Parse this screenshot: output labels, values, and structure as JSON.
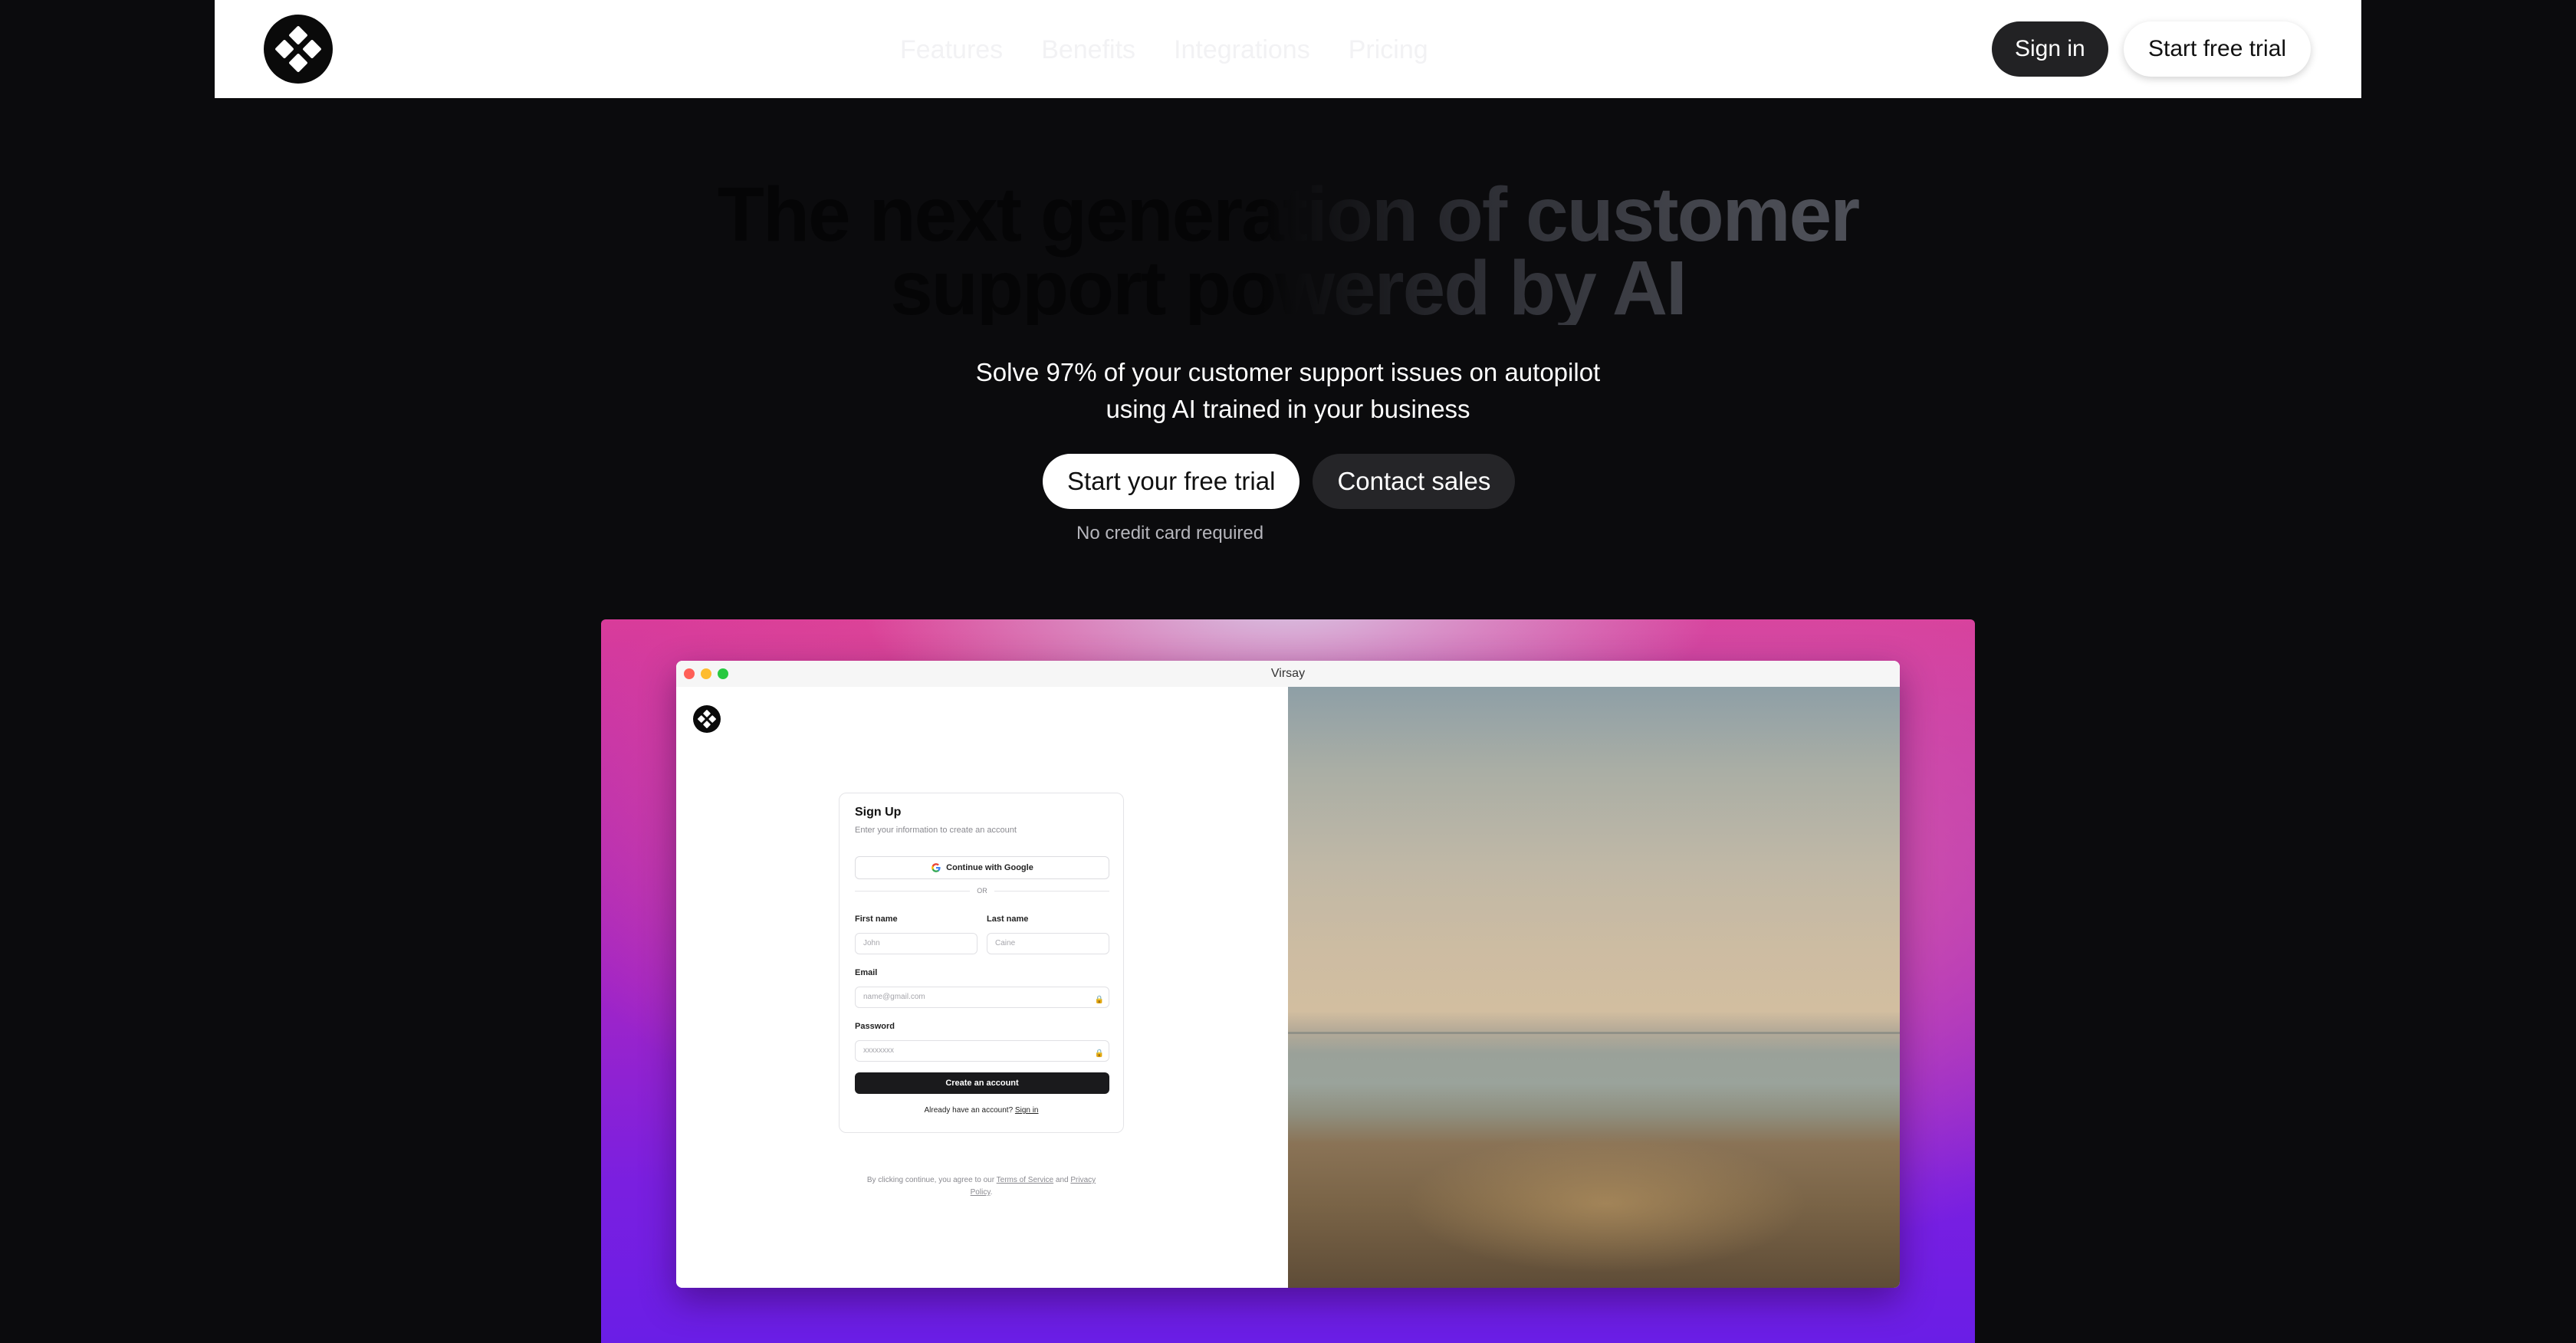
{
  "nav": {
    "links": [
      "Features",
      "Benefits",
      "Integrations",
      "Pricing"
    ],
    "signin_label": "Sign in",
    "trial_label": "Start free trial"
  },
  "hero": {
    "headline_line1": "The next generation of customer",
    "headline_line2": "support powered by AI",
    "subtitle_line1": "Solve 97% of your customer support issues on autopilot",
    "subtitle_line2": "using AI trained in your business",
    "primary_cta": "Start your free trial",
    "secondary_cta": "Contact sales",
    "note": "No credit card required"
  },
  "showcase": {
    "window_title": "Virsay",
    "signup": {
      "title": "Sign Up",
      "description": "Enter your information to create an account",
      "google_button": "Continue with Google",
      "divider": "OR",
      "first_name_label": "First name",
      "first_name_placeholder": "John",
      "last_name_label": "Last name",
      "last_name_placeholder": "Caine",
      "email_label": "Email",
      "email_placeholder": "name@gmail.com",
      "password_label": "Password",
      "password_placeholder": "xxxxxxxx",
      "create_button": "Create an account",
      "have_account": "Already have an account?",
      "signin_link": "Sign in",
      "terms_prefix": "By clicking continue, you agree to our",
      "terms_link": "Terms of Service",
      "terms_and": "and",
      "privacy_link": "Privacy Policy",
      "terms_suffix": "."
    }
  },
  "colors": {
    "page_bg": "#0b0b0d",
    "nav_bg": "#ffffff",
    "dark_button": "#222224",
    "wallpaper_top": "#d93c9a",
    "wallpaper_bottom": "#6a1ee6"
  },
  "icons": [
    "brand-logo-icon",
    "google-icon",
    "lock-icon"
  ]
}
